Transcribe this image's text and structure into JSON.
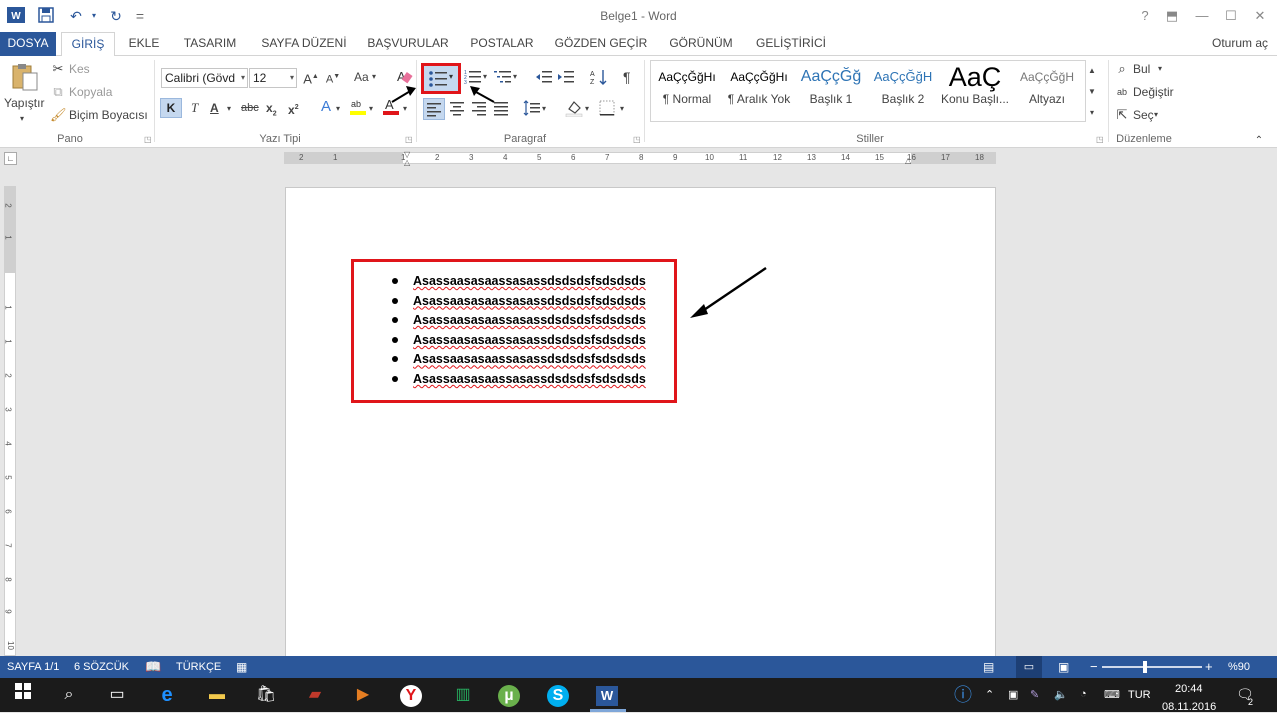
{
  "window": {
    "title": "Belge1 - Word",
    "help": "?",
    "restore_ribbon": "⬒",
    "minimize": "—",
    "maximize": "☐",
    "close": "✕"
  },
  "qat": {
    "save_icon": "save-icon",
    "undo_icon": "undo-icon",
    "redo_icon": "redo-icon",
    "customize": "="
  },
  "tabs": [
    {
      "label": "DOSYA"
    },
    {
      "label": "GİRİŞ"
    },
    {
      "label": "EKLE"
    },
    {
      "label": "TASARIM"
    },
    {
      "label": "SAYFA DÜZENİ"
    },
    {
      "label": "BAŞVURULAR"
    },
    {
      "label": "POSTALAR"
    },
    {
      "label": "GÖZDEN GEÇİR"
    },
    {
      "label": "GÖRÜNÜM"
    },
    {
      "label": "GELİŞTİRİCİ"
    }
  ],
  "account": "Oturum aç",
  "clipboard": {
    "paste": "Yapıştır",
    "cut": "Kes",
    "copy": "Kopyala",
    "format_painter": "Biçim Boyacısı",
    "label": "Pano"
  },
  "font": {
    "name": "Calibri (Gövd",
    "size": "12",
    "change_case": "Aa",
    "bold": "K",
    "italic": "T",
    "underline": "A",
    "strike": "abc",
    "subscript": "x",
    "superscript": "x",
    "label": "Yazı Tipi"
  },
  "paragraph": {
    "label": "Paragraf",
    "pilcrow": "¶"
  },
  "styles": {
    "items": [
      {
        "preview": "AaÇçĞğHı",
        "name": "¶ Normal"
      },
      {
        "preview": "AaÇçĞğHı",
        "name": "¶ Aralık Yok"
      },
      {
        "preview": "AaÇçĞğ",
        "name": "Başlık 1"
      },
      {
        "preview": "AaÇçĞğH",
        "name": "Başlık 2"
      },
      {
        "preview": "AaÇ",
        "name": "Konu Başlı..."
      },
      {
        "preview": "AaÇçĞğH",
        "name": "Altyazı"
      }
    ],
    "label": "Stiller"
  },
  "editing": {
    "find": "Bul",
    "replace": "Değiştir",
    "select": "Seç",
    "label": "Düzenleme"
  },
  "ruler": {
    "h_ticks": [
      "2",
      "1",
      "1",
      "2",
      "3",
      "4",
      "5",
      "6",
      "7",
      "8",
      "9",
      "10",
      "11",
      "12",
      "13",
      "14",
      "15",
      "16",
      "17",
      "18"
    ],
    "v_ticks": [
      "2",
      "1",
      "1",
      "1",
      "2",
      "3",
      "4",
      "5",
      "6",
      "7",
      "8",
      "9",
      "10",
      "11"
    ]
  },
  "document": {
    "bullets": [
      "Asassaasasaassasassdsdsdsfsdsdsds",
      "Asassaasasaassasassdsdsdsfsdsdsds",
      "Asassaasasaassasassdsdsdsfsdsdsds",
      "Asassaasasaassasassdsdsdsfsdsdsds",
      "Asassaasasaassasassdsdsdsfsdsdsds",
      "Asassaasasaassasassdsdsdsfsdsdsds"
    ]
  },
  "status": {
    "page": "SAYFA 1/1",
    "words": "6 SÖZCÜK",
    "language": "TÜRKÇE",
    "zoom_minus": "−",
    "zoom_plus": "+",
    "zoom": "%90"
  },
  "taskbar": {
    "language": "TUR",
    "time": "20:44",
    "date": "08.11.2016",
    "notifications": "2"
  },
  "colors": {
    "word_blue": "#2b579a",
    "highlight_red": "#e0151a",
    "taskbar": "#1b1b1b"
  }
}
